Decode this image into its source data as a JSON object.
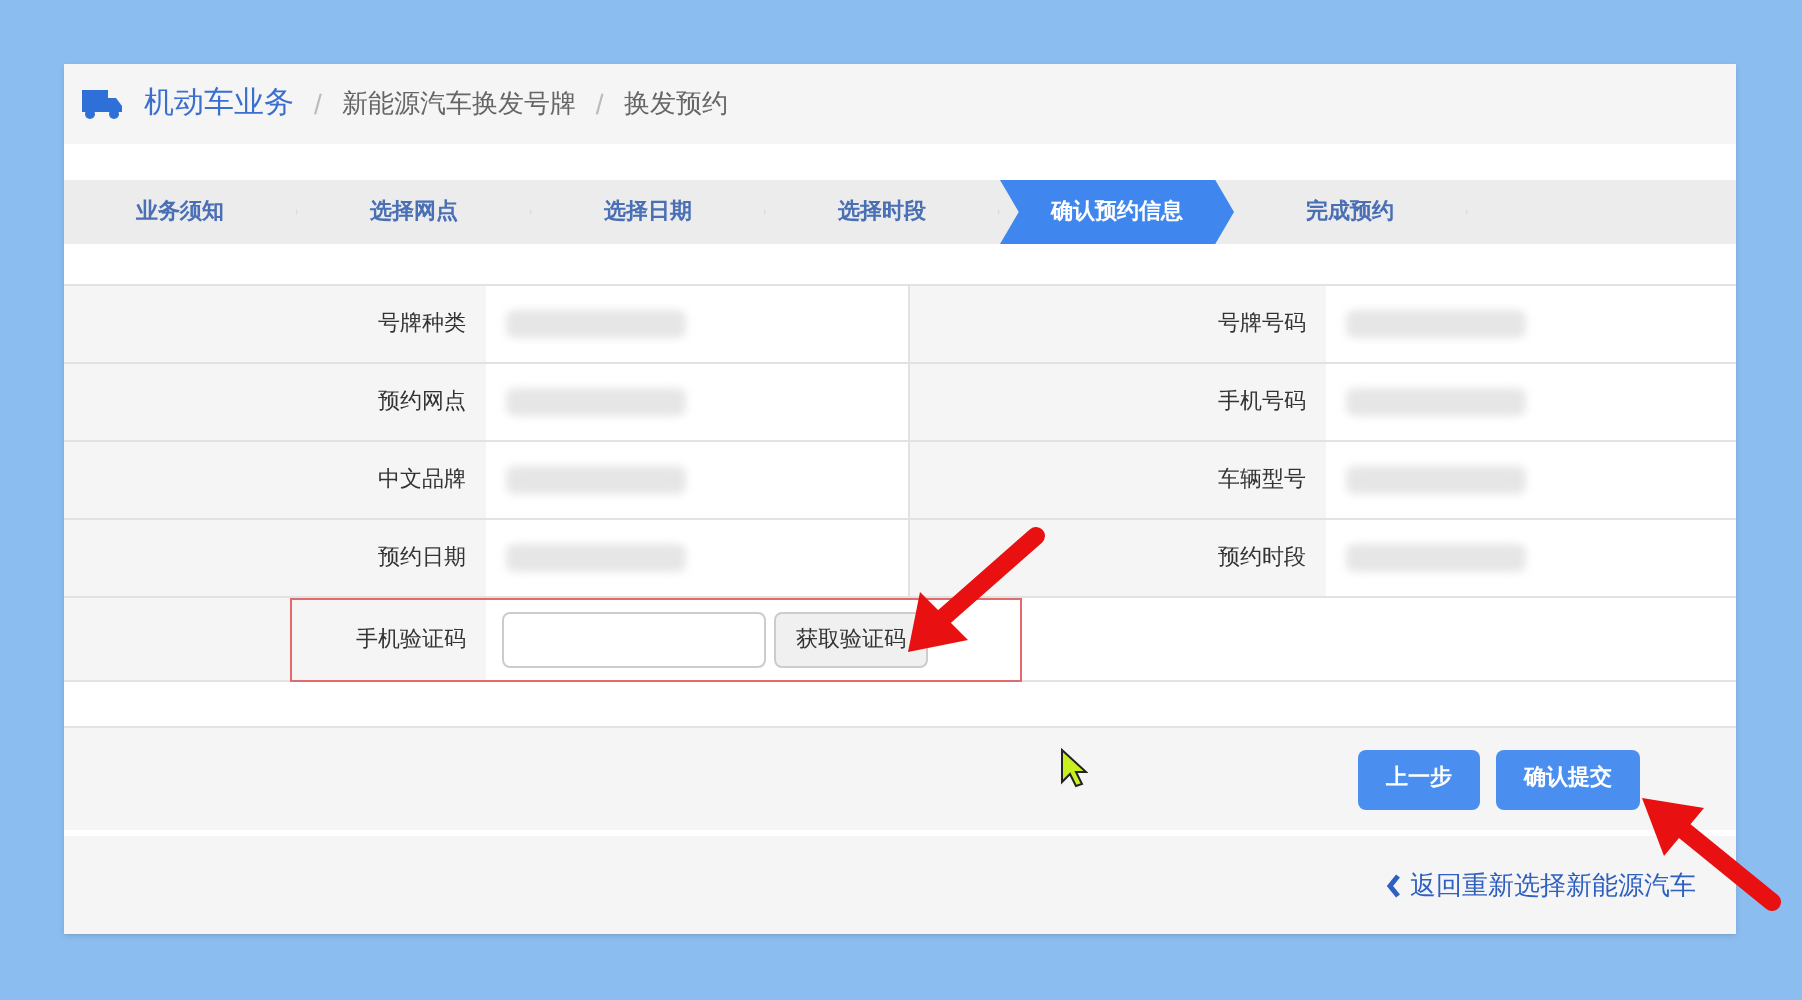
{
  "breadcrumb": [
    "机动车业务",
    "新能源汽车换发号牌",
    "换发预约"
  ],
  "breadcrumb_separator": "/",
  "steps": [
    {
      "label": "业务须知",
      "selected": false
    },
    {
      "label": "选择网点",
      "selected": false
    },
    {
      "label": "选择日期",
      "selected": false
    },
    {
      "label": "选择时段",
      "selected": false
    },
    {
      "label": "确认预约信息",
      "selected": true
    },
    {
      "label": "完成预约",
      "selected": false
    }
  ],
  "rows": [
    [
      "号牌种类",
      "号牌号码"
    ],
    [
      "预约网点",
      "手机号码"
    ],
    [
      "中文品牌",
      "车辆型号"
    ],
    [
      "预约日期",
      "预约时段"
    ]
  ],
  "verify": {
    "label": "手机验证码",
    "button": "获取验证码"
  },
  "buttons": [
    "上一步",
    "确认提交"
  ],
  "back_link": "返回重新选择新能源汽车"
}
